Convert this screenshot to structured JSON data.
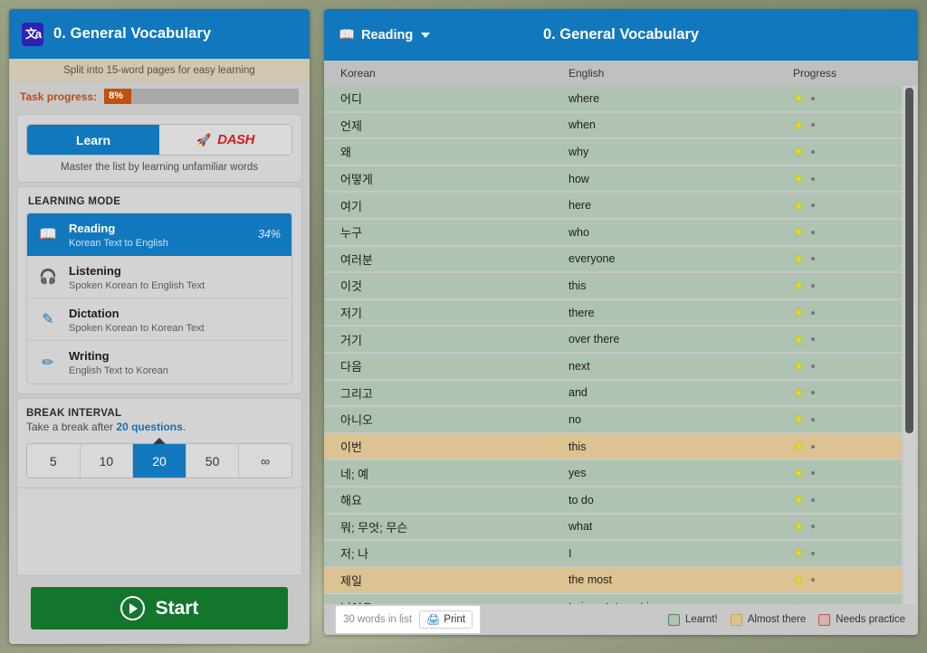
{
  "left": {
    "app_icon": "translate-icon",
    "title": "0. General Vocabulary",
    "subbar": "Split into 15-word pages for easy learning",
    "progress_label": "Task progress:",
    "progress_value": "8%",
    "toggle": {
      "learn": "Learn",
      "dash": "DASH",
      "rocket_icon": "rocket-icon"
    },
    "mode_help": "Master the list by learning unfamiliar words",
    "learning_mode_label": "LEARNING MODE",
    "modes": [
      {
        "name": "Reading",
        "sub": "Korean Text to English",
        "pct": "34%",
        "icon": "book-icon",
        "active": true
      },
      {
        "name": "Listening",
        "sub": "Spoken Korean to English Text",
        "pct": "",
        "icon": "headphones-icon",
        "active": false
      },
      {
        "name": "Dictation",
        "sub": "Spoken Korean to Korean Text",
        "pct": "",
        "icon": "mic-pencil-icon",
        "active": false
      },
      {
        "name": "Writing",
        "sub": "English Text to Korean",
        "pct": "",
        "icon": "pencil-icon",
        "active": false
      }
    ],
    "break_title": "BREAK INTERVAL",
    "break_sub_pre": "Take a break after ",
    "break_sub_val": "20 questions",
    "break_sub_post": ".",
    "break_options": [
      "5",
      "10",
      "20",
      "50",
      "∞"
    ],
    "break_selected": "20",
    "start_label": "Start"
  },
  "right": {
    "mode_label": "Reading",
    "mode_icon": "book-icon",
    "title": "0. General Vocabulary",
    "columns": {
      "korean": "Korean",
      "english": "English",
      "progress": "Progress"
    },
    "rows": [
      {
        "korean": "어디",
        "english": "where",
        "state": "learnt"
      },
      {
        "korean": "언제",
        "english": "when",
        "state": "learnt"
      },
      {
        "korean": "왜",
        "english": "why",
        "state": "learnt"
      },
      {
        "korean": "어떻게",
        "english": "how",
        "state": "learnt"
      },
      {
        "korean": "여기",
        "english": "here",
        "state": "learnt"
      },
      {
        "korean": "누구",
        "english": "who",
        "state": "learnt"
      },
      {
        "korean": "여러분",
        "english": "everyone",
        "state": "learnt"
      },
      {
        "korean": "이것",
        "english": "this",
        "state": "learnt"
      },
      {
        "korean": "저기",
        "english": "there",
        "state": "learnt"
      },
      {
        "korean": "거기",
        "english": "over there",
        "state": "learnt"
      },
      {
        "korean": "다음",
        "english": "next",
        "state": "learnt"
      },
      {
        "korean": "그리고",
        "english": "and",
        "state": "learnt"
      },
      {
        "korean": "아니오",
        "english": "no",
        "state": "learnt"
      },
      {
        "korean": "이번",
        "english": "this",
        "state": "almost"
      },
      {
        "korean": "네; 예",
        "english": "yes",
        "state": "learnt"
      },
      {
        "korean": "해요",
        "english": "to do",
        "state": "learnt"
      },
      {
        "korean": "뭐; 무엇; 무슨",
        "english": "what",
        "state": "learnt"
      },
      {
        "korean": "저; 나",
        "english": "I",
        "state": "learnt"
      },
      {
        "korean": "제일",
        "english": "the most",
        "state": "almost"
      },
      {
        "korean": "넣어요",
        "english": "to insert; to put in",
        "state": "learnt"
      }
    ],
    "footer": {
      "words_in_list": "30 words in list",
      "print_label": "Print",
      "print_icon": "printer-icon",
      "legend": [
        {
          "label": "Learnt!",
          "fill": "#aec3b2",
          "border": "#4a8a5c"
        },
        {
          "label": "Almost there",
          "fill": "#ddc392",
          "border": "#c9a44a"
        },
        {
          "label": "Needs practice",
          "fill": "#d6b3b0",
          "border": "#c05050"
        }
      ]
    }
  }
}
